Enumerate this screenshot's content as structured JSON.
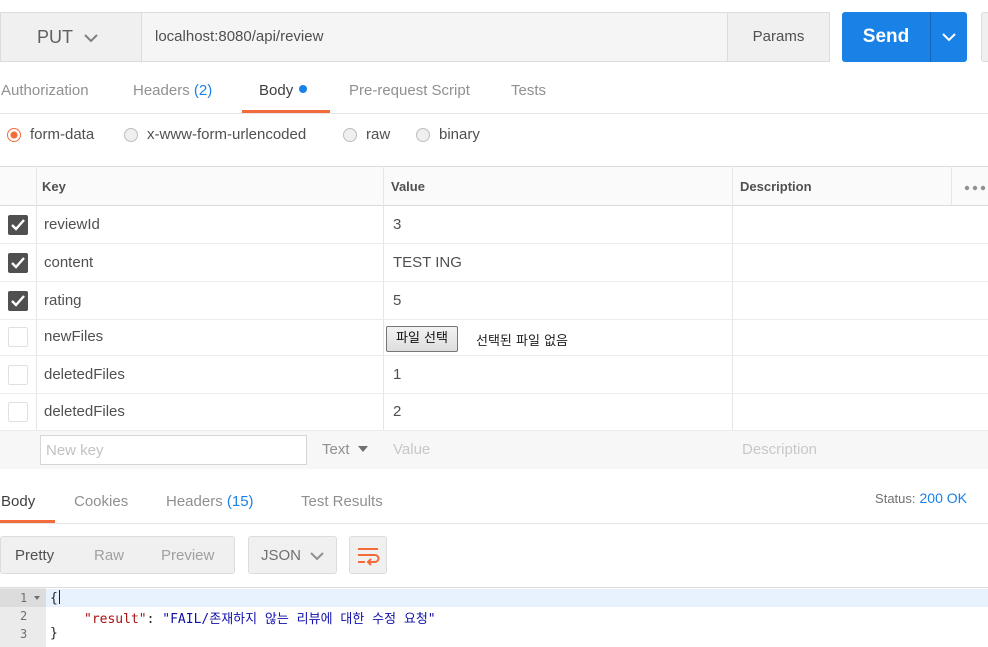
{
  "request": {
    "method": "PUT",
    "url": "localhost:8080/api/review",
    "params_label": "Params",
    "send_label": "Send"
  },
  "request_tabs": {
    "authorization": "Authorization",
    "headers": "Headers",
    "headers_count": "(2)",
    "body": "Body",
    "prerequest": "Pre-request Script",
    "tests": "Tests"
  },
  "body_types": {
    "selected": "form-data",
    "options": [
      "form-data",
      "x-www-form-urlencoded",
      "raw",
      "binary"
    ]
  },
  "form_table": {
    "headers": {
      "key": "Key",
      "value": "Value",
      "description": "Description"
    },
    "rows": [
      {
        "checked": true,
        "key": "reviewId",
        "value": "3"
      },
      {
        "checked": true,
        "key": "content",
        "value": "TEST ING"
      },
      {
        "checked": true,
        "key": "rating",
        "value": "5"
      },
      {
        "checked": false,
        "key": "newFiles",
        "file_button": "파일 선택",
        "file_status": "선택된 파일 없음"
      },
      {
        "checked": false,
        "key": "deletedFiles",
        "value": "1"
      },
      {
        "checked": false,
        "key": "deletedFiles",
        "value": "2"
      }
    ],
    "new_row": {
      "key_placeholder": "New key",
      "type": "Text",
      "value_placeholder": "Value",
      "description_placeholder": "Description"
    }
  },
  "response": {
    "tabs": {
      "body": "Body",
      "cookies": "Cookies",
      "headers": "Headers",
      "headers_count": "(15)",
      "test_results": "Test Results"
    },
    "status_label": "Status:",
    "status_value": "200 OK",
    "view_modes": {
      "pretty": "Pretty",
      "raw": "Raw",
      "preview": "Preview"
    },
    "format": "JSON",
    "code": {
      "line_numbers": [
        "1",
        "2",
        "3"
      ],
      "open_brace": "{",
      "key": "\"result\"",
      "colon": ": ",
      "value": "\"FAIL/존재하지 않는 리뷰에 대한 수정 요청\"",
      "close_brace": "}"
    }
  },
  "colors": {
    "accent_orange": "#f26b3a",
    "primary_blue": "#1a81e6"
  },
  "icons": [
    "chevron-down-icon",
    "checkmark-icon",
    "wrap-lines-icon",
    "more-options-icon",
    "fold-arrow-icon"
  ]
}
